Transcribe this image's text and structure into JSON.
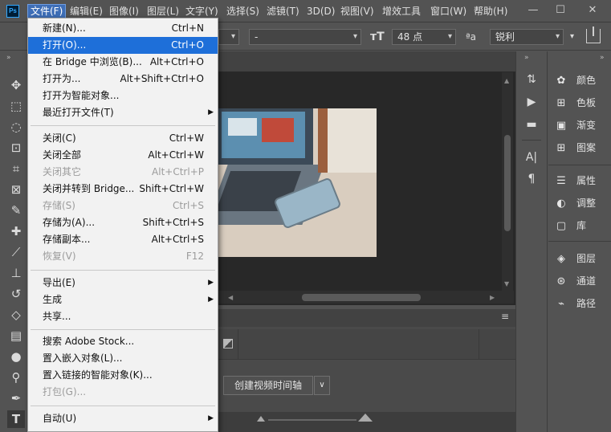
{
  "app": {
    "logo": "Ps"
  },
  "menubar": {
    "items": [
      "文件(F)",
      "编辑(E)",
      "图像(I)",
      "图层(L)",
      "文字(Y)",
      "选择(S)",
      "滤镜(T)",
      "3D(D)",
      "视图(V)",
      "增效工具",
      "窗口(W)",
      "帮助(H)"
    ]
  },
  "window_controls": {
    "minimize": "—",
    "maximize": "☐",
    "close": "✕"
  },
  "options": {
    "font_style": "-",
    "font_size": "48 点",
    "aa_label": "ªa",
    "antialias": "锐利"
  },
  "file_menu": {
    "items": [
      {
        "label": "新建(N)...",
        "shortcut": "Ctrl+N"
      },
      {
        "label": "打开(O)...",
        "shortcut": "Ctrl+O"
      },
      {
        "label": "在 Bridge 中浏览(B)...",
        "shortcut": "Alt+Ctrl+O"
      },
      {
        "label": "打开为...",
        "shortcut": "Alt+Shift+Ctrl+O"
      },
      {
        "label": "打开为智能对象...",
        "shortcut": ""
      },
      {
        "label": "最近打开文件(T)",
        "shortcut": ""
      },
      {
        "label": "关闭(C)",
        "shortcut": "Ctrl+W"
      },
      {
        "label": "关闭全部",
        "shortcut": "Alt+Ctrl+W"
      },
      {
        "label": "关闭其它",
        "shortcut": "Alt+Ctrl+P"
      },
      {
        "label": "关闭并转到 Bridge...",
        "shortcut": "Shift+Ctrl+W"
      },
      {
        "label": "存储(S)",
        "shortcut": "Ctrl+S"
      },
      {
        "label": "存储为(A)...",
        "shortcut": "Shift+Ctrl+S"
      },
      {
        "label": "存储副本...",
        "shortcut": "Alt+Ctrl+S"
      },
      {
        "label": "恢复(V)",
        "shortcut": "F12"
      },
      {
        "label": "导出(E)",
        "shortcut": ""
      },
      {
        "label": "生成",
        "shortcut": ""
      },
      {
        "label": "共享...",
        "shortcut": ""
      },
      {
        "label": "搜索 Adobe Stock...",
        "shortcut": ""
      },
      {
        "label": "置入嵌入对象(L)...",
        "shortcut": ""
      },
      {
        "label": "置入链接的智能对象(K)...",
        "shortcut": ""
      },
      {
        "label": "打包(G)...",
        "shortcut": ""
      },
      {
        "label": "自动(U)",
        "shortcut": ""
      }
    ]
  },
  "timeline": {
    "create_button": "创建视频时间轴"
  },
  "panels": {
    "items": [
      "颜色",
      "色板",
      "渐变",
      "图案",
      "属性",
      "调整",
      "库",
      "图层",
      "通道",
      "路径"
    ]
  },
  "icons": {
    "tools": [
      "move-icon",
      "marquee-icon",
      "lasso-icon",
      "quick-select-icon",
      "crop-icon",
      "frame-icon",
      "eyedropper-icon",
      "healing-icon",
      "brush-icon",
      "stamp-icon",
      "history-brush-icon",
      "eraser-icon",
      "gradient-icon",
      "blur-icon",
      "dodge-icon",
      "pen-icon",
      "type-icon"
    ]
  }
}
